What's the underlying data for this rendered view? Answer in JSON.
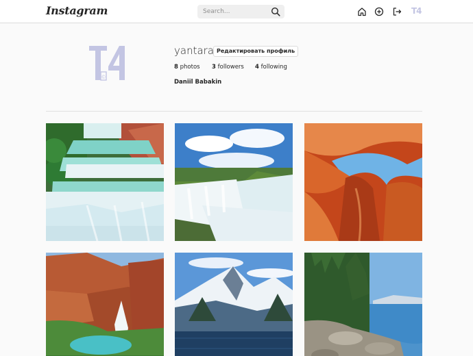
{
  "header": {
    "logo_text": "Instagram",
    "search_placeholder": "Search...",
    "mini_logo": "T4",
    "icons": [
      "home-icon",
      "new-post-icon",
      "logout-icon"
    ]
  },
  "profile": {
    "username": "yantara",
    "edit_button": "Редактировать профиль",
    "photos_count": "8",
    "photos_label": "photos",
    "followers_count": "3",
    "followers_label": "followers",
    "following_count": "4",
    "following_label": "following",
    "full_name": "Daniil Babakin",
    "avatar_logo": "T4",
    "avatar_color": "#c3c5e3"
  },
  "posts": [
    "waterfall-terraces",
    "niagara-falls",
    "antelope-canyon",
    "havasu-falls",
    "snowy-mountain-lake",
    "lake-tahoe-shore"
  ]
}
